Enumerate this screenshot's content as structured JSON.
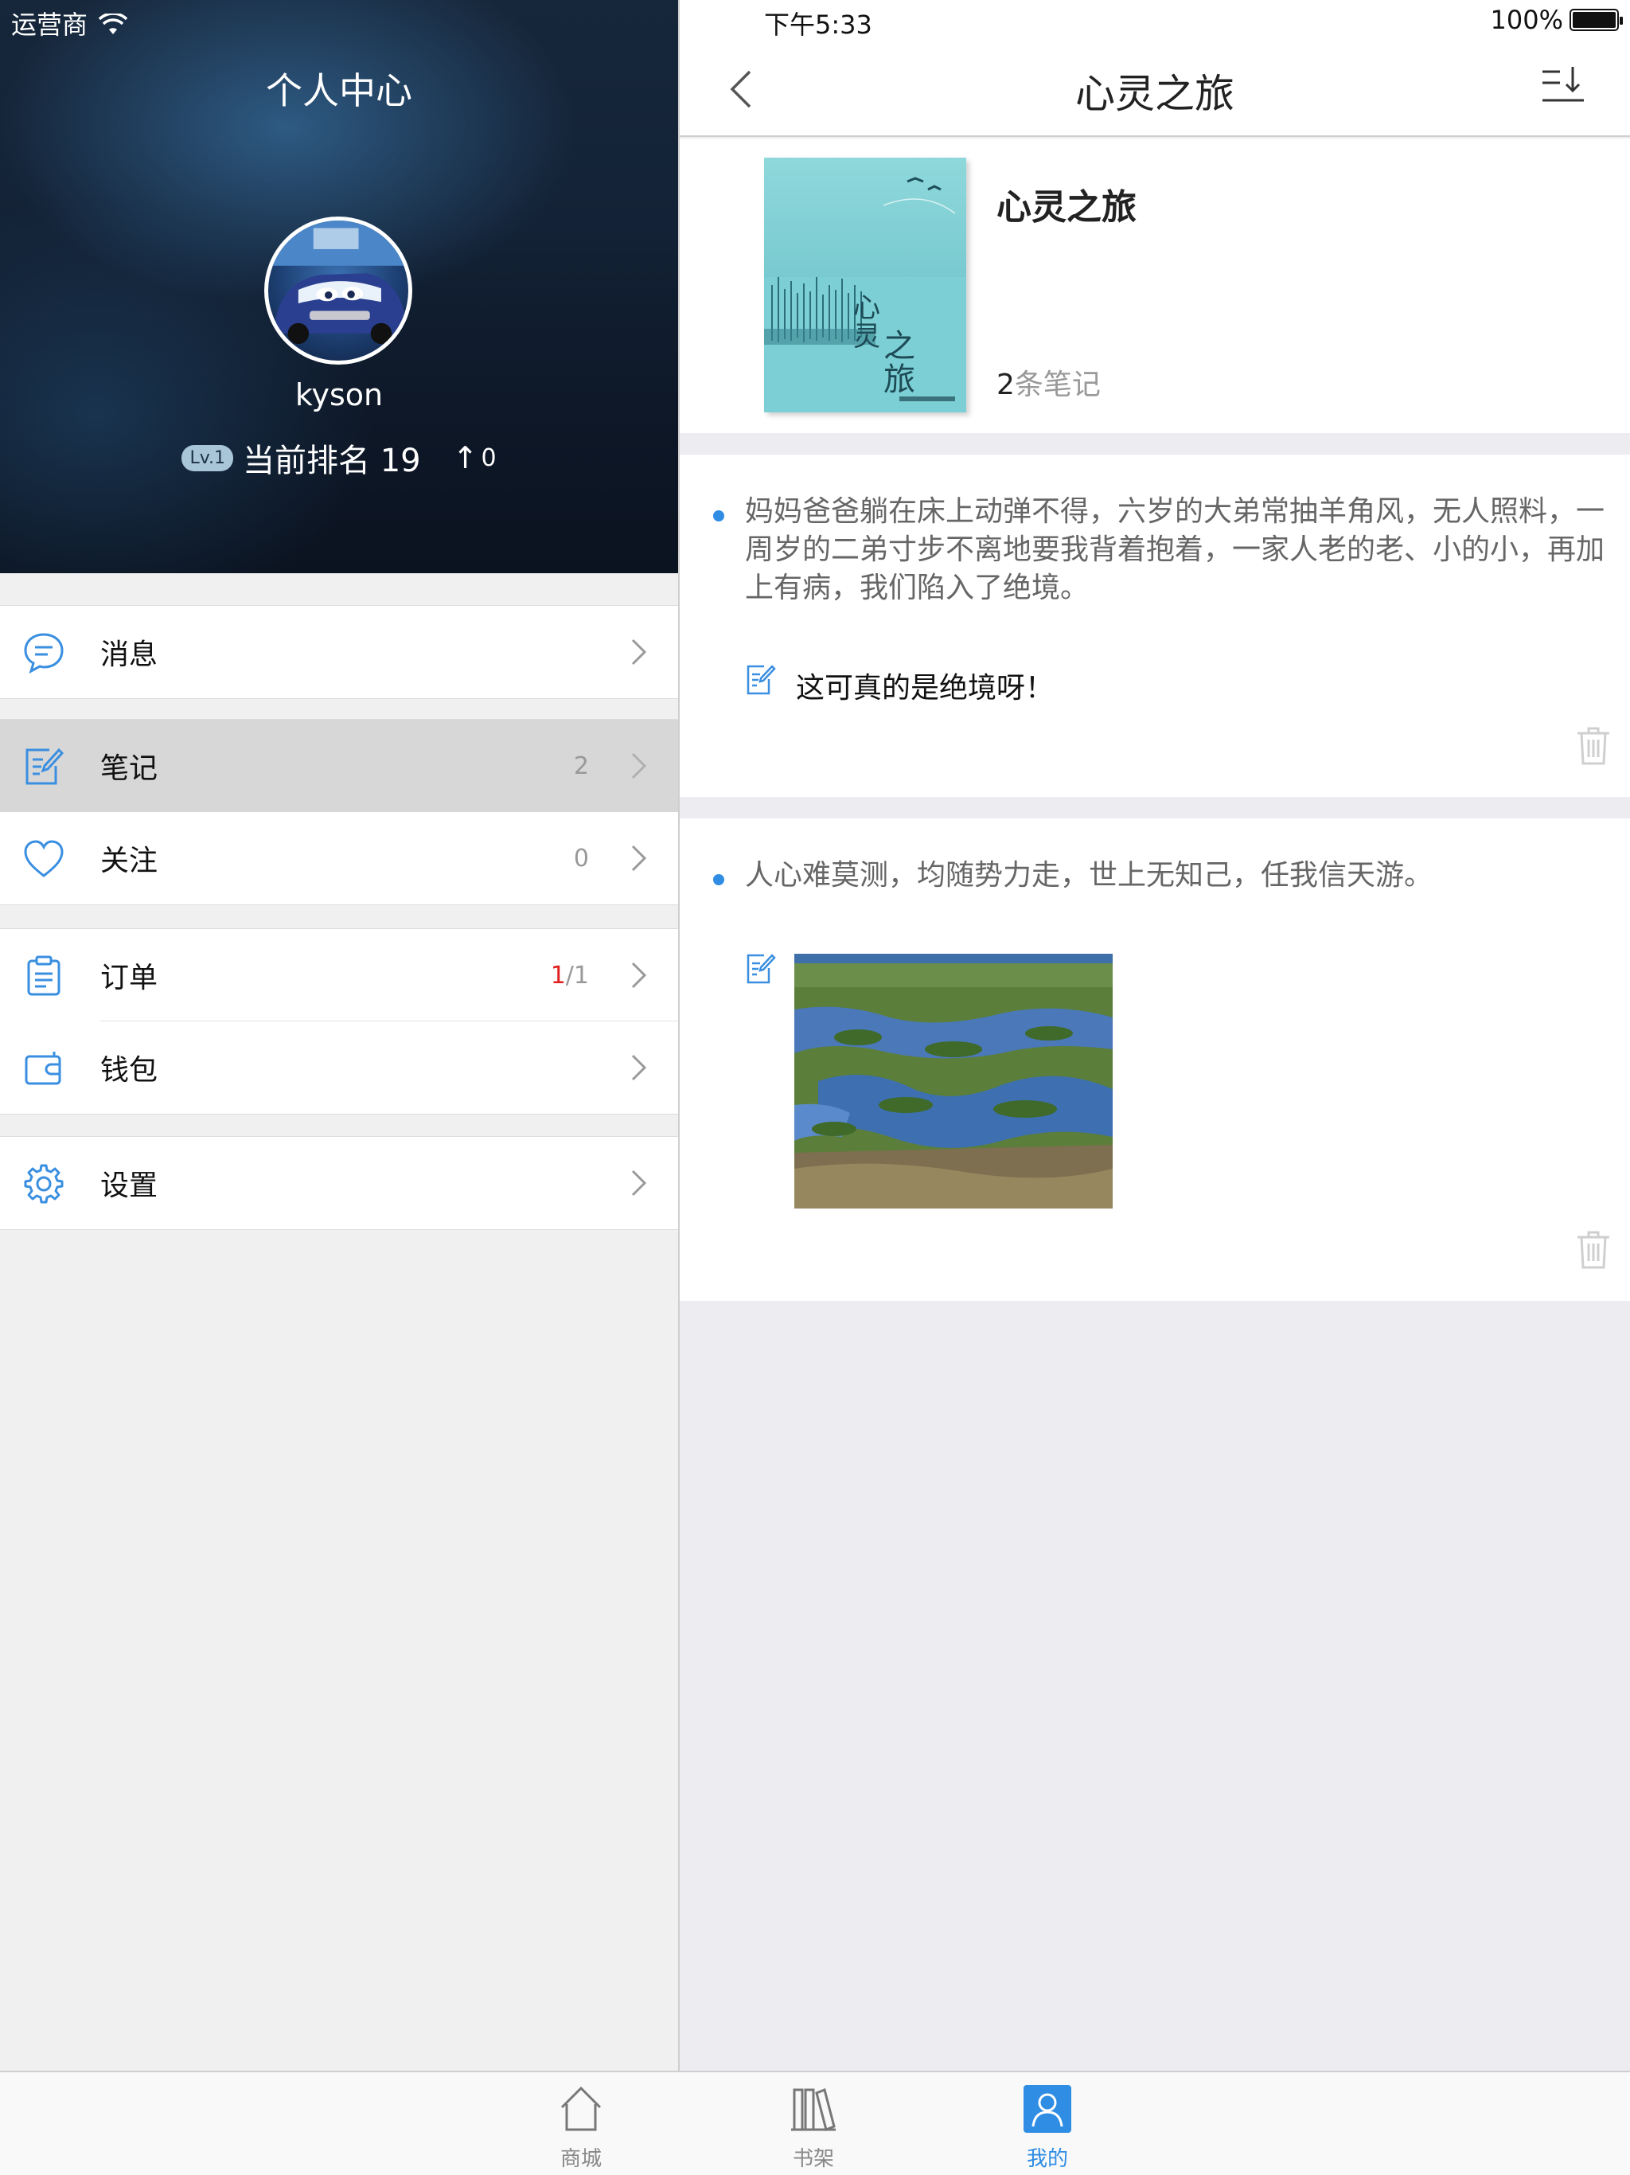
{
  "status_bar": {
    "carrier": "运营商",
    "time": "下午5:33",
    "battery": "100%"
  },
  "left_panel": {
    "title": "个人中心",
    "username": "kyson",
    "level": "Lv.1",
    "rank_text": "当前排名 19",
    "rank_change_symbol": "↑",
    "rank_change": "0",
    "menu_groups": [
      [
        {
          "label": "消息",
          "count": "",
          "icon": "message-icon"
        }
      ],
      [
        {
          "label": "笔记",
          "count": "2",
          "icon": "note-icon",
          "active": true
        },
        {
          "label": "关注",
          "count": "0",
          "icon": "heart-icon"
        }
      ],
      [
        {
          "label": "订单",
          "count_red": "1",
          "count_rest": "/1",
          "icon": "clipboard-icon"
        },
        {
          "label": "钱包",
          "count": "",
          "icon": "wallet-icon"
        }
      ],
      [
        {
          "label": "设置",
          "count": "",
          "icon": "gear-icon"
        }
      ]
    ]
  },
  "right_panel": {
    "nav_title": "心灵之旅",
    "book": {
      "title": "心灵之旅",
      "note_count_num": "2",
      "note_count_suffix": "条笔记",
      "cover_title": "心灵之旅"
    },
    "notes": [
      {
        "quote": "妈妈爸爸躺在床上动弹不得，六岁的大弟常抽羊角风，无人照料，一周岁的二弟寸步不离地要我背着抱着，一家人老的老、小的小，再加上有病，我们陷入了绝境。",
        "comment": "这可真的是绝境呀！"
      },
      {
        "quote": "人心难莫测，均随势力走，世上无知己，任我信天游。",
        "comment": ""
      }
    ]
  },
  "tabbar": {
    "tabs": [
      {
        "label": "商城",
        "icon": "home-icon"
      },
      {
        "label": "书架",
        "icon": "bookshelf-icon"
      },
      {
        "label": "我的",
        "icon": "person-icon",
        "active": true
      }
    ]
  },
  "colors": {
    "accent": "#2f8de4",
    "active_row": "#d7d7d7",
    "order_red": "#e02020"
  }
}
